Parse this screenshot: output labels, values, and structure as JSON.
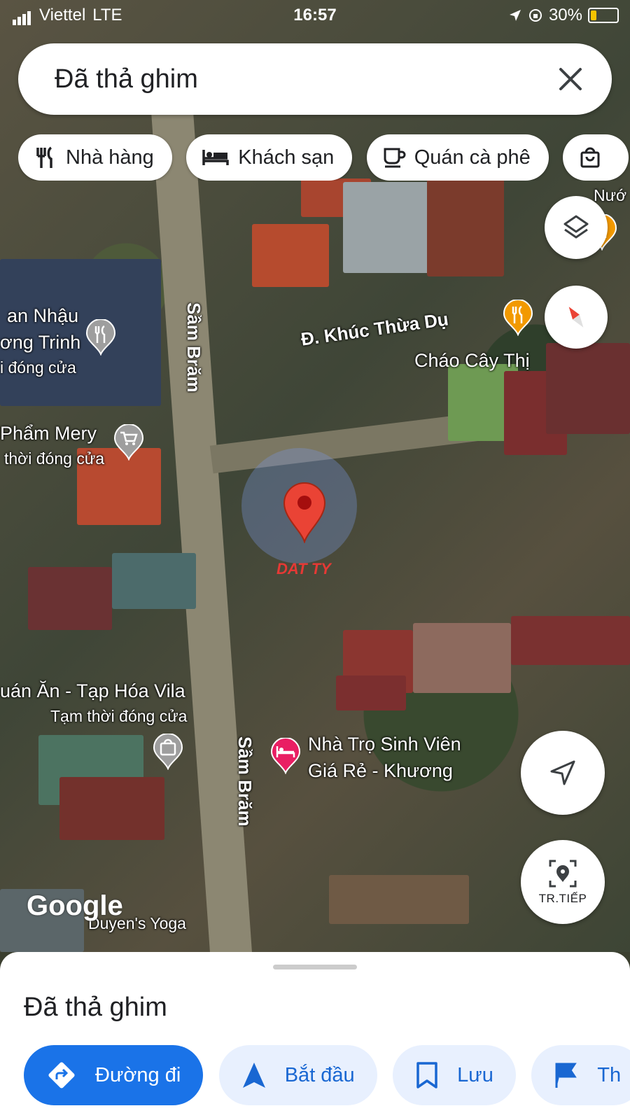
{
  "status_bar": {
    "carrier": "Viettel",
    "network": "LTE",
    "time": "16:57",
    "battery": "30%"
  },
  "search": {
    "text": "Đã thả ghim",
    "close_icon": "close-icon"
  },
  "chips": [
    {
      "label": "Nhà hàng",
      "icon": "restaurant-icon"
    },
    {
      "label": "Khách sạn",
      "icon": "hotel-icon"
    },
    {
      "label": "Quán cà phê",
      "icon": "coffee-icon"
    },
    {
      "label": "",
      "icon": "shopping-bag-icon"
    }
  ],
  "map_labels": {
    "poi1_line1": "an Nhậu",
    "poi1_line2": "ơng Trinh",
    "poi1_status": "i đóng cửa",
    "poi2_line1": "Phẩm Mery",
    "poi2_status": "thời đóng cửa",
    "street_1": "Sầm Brăm",
    "street_2": "Sầm Brăm",
    "street_3": "Đ. Khúc Thừa Dụ",
    "poi3": "Cháo Cây Thị",
    "poi4_line1": "uán Ăn - Tạp Hóa Vila",
    "poi4_status": "Tạm thời đóng cửa",
    "poi5_line1": "Nhà Trọ Sinh Viên",
    "poi5_line2": "Giá Rẻ - Khương",
    "poi6": "Duyen's Yoga",
    "poi7": "Nướ",
    "watermark": "DAT TY",
    "google": "Google"
  },
  "fabs": {
    "layers": "layers-icon",
    "compass": "compass-icon",
    "location": "navigation-arrow-icon",
    "next_label": "TR.TIẾP"
  },
  "sheet": {
    "title": "Đã thả ghim",
    "actions": [
      {
        "label": "Đường đi",
        "icon": "directions-icon"
      },
      {
        "label": "Bắt đầu",
        "icon": "navigation-icon"
      },
      {
        "label": "Lưu",
        "icon": "bookmark-icon"
      },
      {
        "label": "Th",
        "icon": "flag-icon"
      }
    ]
  },
  "colors": {
    "primary_blue": "#1a73e8",
    "pin_red": "#ea4335",
    "restaurant_orange": "#f29900"
  }
}
